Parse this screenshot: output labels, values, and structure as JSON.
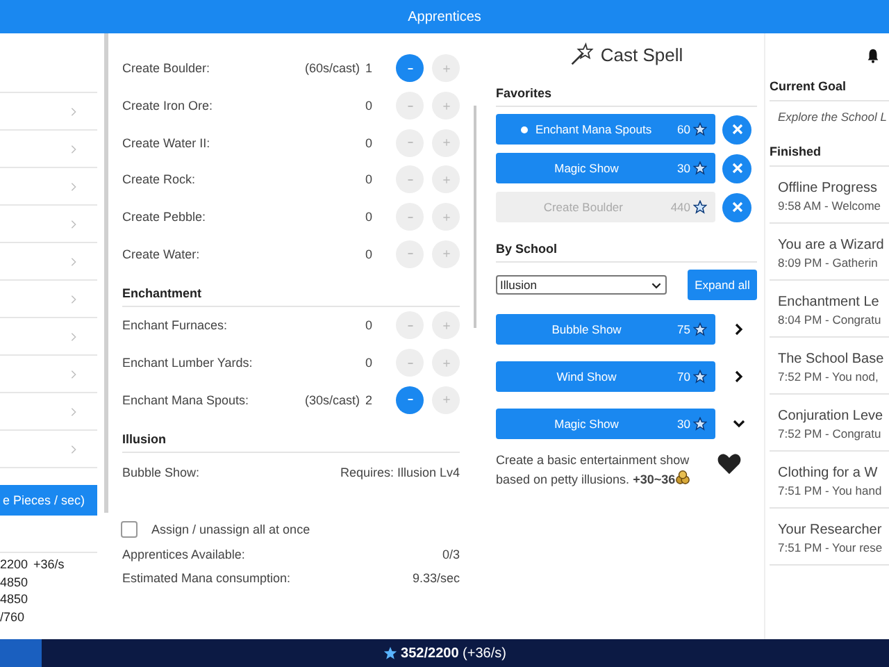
{
  "top_bar": {
    "title": "Apprentices"
  },
  "left_panel": {
    "button": "e Pieces / sec)",
    "stats": [
      {
        "value": "2200",
        "rate": "+36/s"
      },
      {
        "value": "4850"
      },
      {
        "value": "4850"
      },
      {
        "value": "/760"
      }
    ]
  },
  "assignments": {
    "sections": [
      {
        "rows": [
          {
            "kind": "counter",
            "label": "Create Boulder:",
            "note": "(60s/cast)",
            "count": "1",
            "minus_enabled": true
          },
          {
            "kind": "counter",
            "label": "Create Iron Ore:",
            "count": "0",
            "minus_enabled": false
          },
          {
            "kind": "counter",
            "label": "Create Water II:",
            "count": "0",
            "minus_enabled": false
          },
          {
            "kind": "counter",
            "label": "Create Rock:",
            "count": "0",
            "minus_enabled": false
          },
          {
            "kind": "counter",
            "label": "Create Pebble:",
            "count": "0",
            "minus_enabled": false
          },
          {
            "kind": "counter",
            "label": "Create Water:",
            "count": "0",
            "minus_enabled": false
          }
        ]
      },
      {
        "heading": "Enchantment",
        "rows": [
          {
            "kind": "counter",
            "label": "Enchant Furnaces:",
            "count": "0",
            "minus_enabled": false
          },
          {
            "kind": "counter",
            "label": "Enchant Lumber Yards:",
            "count": "0",
            "minus_enabled": false
          },
          {
            "kind": "counter",
            "label": "Enchant Mana Spouts:",
            "note": "(30s/cast)",
            "count": "2",
            "minus_enabled": true
          }
        ]
      },
      {
        "heading": "Illusion",
        "rows": [
          {
            "kind": "locked",
            "label": "Bubble Show:",
            "requirement": "Requires: Illusion Lv4"
          }
        ]
      }
    ],
    "assign_all": {
      "label": "Assign / unassign all at once",
      "checked": false
    },
    "stats": [
      {
        "label": "Apprentices Available:",
        "value": "0/3"
      },
      {
        "label": "Estimated Mana consumption:",
        "value": "9.33/sec"
      }
    ]
  },
  "cast_spell": {
    "title": "Cast Spell",
    "favorites_heading": "Favorites",
    "favorites": [
      {
        "name": "Enchant Mana Spouts",
        "cost": "60",
        "active": true,
        "disabled": false
      },
      {
        "name": "Magic Show",
        "cost": "30",
        "active": false,
        "disabled": false
      },
      {
        "name": "Create Boulder",
        "cost": "440",
        "active": false,
        "disabled": true
      }
    ],
    "school_heading": "By School",
    "school_select": "Illusion",
    "expand_button": "Expand all",
    "school_spells": [
      {
        "name": "Bubble Show",
        "cost": "75",
        "expanded": false
      },
      {
        "name": "Wind Show",
        "cost": "70",
        "expanded": false
      },
      {
        "name": "Magic Show",
        "cost": "30",
        "expanded": true
      }
    ],
    "description": "Create a basic entertainment show based on petty illusions. **+30~36**"
  },
  "log": {
    "goal_heading": "Current Goal",
    "goal": "Explore the School L",
    "finished_heading": "Finished",
    "events": [
      {
        "title": "Offline Progress",
        "detail": "9:58 AM - Welcome"
      },
      {
        "title": "You are a Wizard",
        "detail": "8:09 PM - Gatherin"
      },
      {
        "title": "Enchantment Le",
        "detail": "8:04 PM - Congratu"
      },
      {
        "title": "The School Base",
        "detail": "7:52 PM - You nod,"
      },
      {
        "title": "Conjuration Leve",
        "detail": "7:52 PM - Congratu"
      },
      {
        "title": "Clothing for a W",
        "detail": "7:51 PM - You hand"
      },
      {
        "title": "Your Researcher",
        "detail": "7:51 PM - Your rese"
      }
    ]
  },
  "status_bar": {
    "mana": "**352/2200** (+36/s)"
  }
}
